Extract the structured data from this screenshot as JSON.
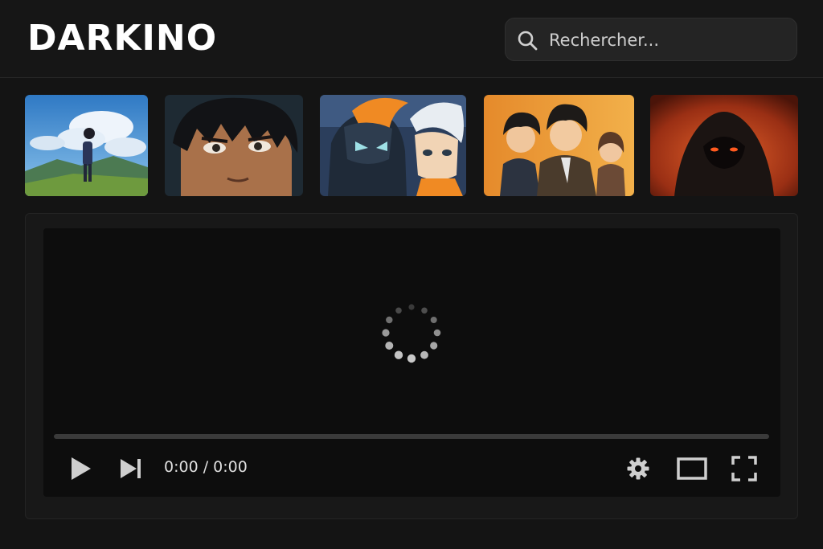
{
  "app": {
    "logo_text": "DARKINO"
  },
  "search": {
    "placeholder": "Rechercher...",
    "value": "",
    "icon": "search-icon"
  },
  "thumbnails": [
    {
      "subject": "boy-on-hill-under-clouds"
    },
    {
      "subject": "dark-haired-boy-closeup"
    },
    {
      "subject": "orange-horned-mecha-and-white-haired-boy"
    },
    {
      "subject": "three-characters-orange-background"
    },
    {
      "subject": "hooded-figure-red-eyes-fire"
    }
  ],
  "player": {
    "state": "loading",
    "current_time": "0:00",
    "duration": "0:00",
    "time_display": "0:00 / 0:00",
    "progress": 0,
    "controls": [
      "play-icon",
      "next-icon",
      "settings-gear-icon",
      "theater-mode-icon",
      "fullscreen-icon"
    ]
  },
  "colors": {
    "background": "#141414",
    "header": "#161616",
    "search_box": "#242424",
    "player": "#0d0d0d",
    "controls": "#cfcfcf"
  }
}
